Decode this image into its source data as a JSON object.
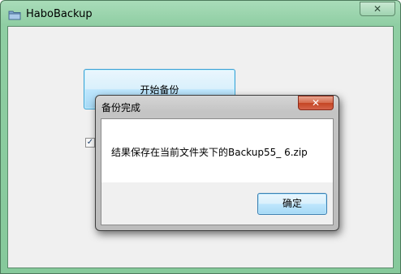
{
  "window": {
    "title": "HaboBackup",
    "close_glyph": "✕",
    "icon": "folder-icon"
  },
  "main": {
    "start_button_label": "开始备份",
    "checkbox_checked": true,
    "checkbox_glyph": "✓"
  },
  "dialog": {
    "title": "备份完成",
    "close_glyph": "✕",
    "message": "结果保存在当前文件夹下的Backup55_ 6.zip",
    "ok_label": "确定"
  },
  "colors": {
    "frame_accent": "#8fcea3",
    "button_blue": "#a7d9f5",
    "dialog_close_red": "#c44523"
  }
}
